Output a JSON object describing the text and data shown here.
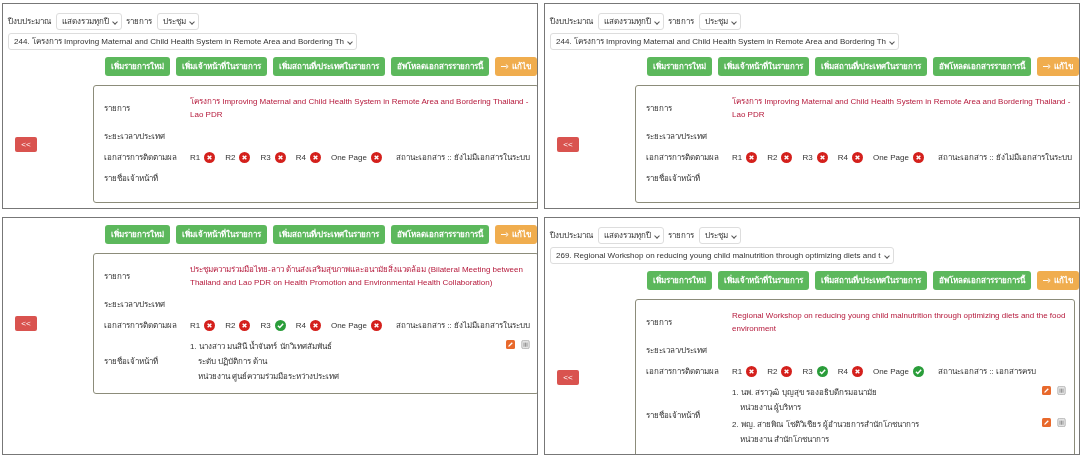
{
  "panels": [
    {
      "filters": {
        "year_label": "ปีงบประมาณ",
        "year": "แสดงรวมทุกปี",
        "type_label": "รายการ",
        "type": "ประชุม",
        "project": "244. โครงการ Improving Maternal and Child Health System in Remote Area and Bordering Th"
      },
      "buttons": [
        "เพิ่มรายการใหม่",
        "เพิ่มเจ้าหน้าที่ในรายการ",
        "เพิ่มสถานที่/ประเทศในรายการ",
        "อัพโหลดเอกสารรายการนี้"
      ],
      "edit_button": "แก้ไข",
      "back_button": "<<",
      "details": {
        "project_label": "รายการ",
        "project": "โครงการ Improving Maternal and Child Health System in Remote Area and Bordering Thailand - Lao PDR",
        "period_label": "ระยะเวลา/ประเทศ",
        "docs_label": "เอกสารการติดตามผล",
        "docs": [
          {
            "label": "R1",
            "done": false
          },
          {
            "label": "R2",
            "done": false
          },
          {
            "label": "R3",
            "done": false
          },
          {
            "label": "R4",
            "done": false
          },
          {
            "label": "One Page",
            "done": false
          }
        ],
        "doc_status": "สถานะเอกสาร :: ยังไม่มีเอกสารในระบบ",
        "staff_label": "รายชื่อเจ้าหน้าที่"
      }
    },
    {
      "filters": {
        "year_label": "ปีงบประมาณ",
        "year": "แสดงรวมทุกปี",
        "type_label": "รายการ",
        "type": "ประชุม",
        "project": "244. โครงการ Improving Maternal and Child Health System in Remote Area and Bordering Th"
      },
      "buttons": [
        "เพิ่มรายการใหม่",
        "เพิ่มเจ้าหน้าที่ในรายการ",
        "เพิ่มสถานที่/ประเทศในรายการ",
        "อัพโหลดเอกสารรายการนี้"
      ],
      "edit_button": "แก้ไข",
      "back_button": "<<",
      "details": {
        "project_label": "รายการ",
        "project": "โครงการ Improving Maternal and Child Health System in Remote Area and Bordering Thailand - Lao PDR",
        "period_label": "ระยะเวลา/ประเทศ",
        "docs_label": "เอกสารการติดตามผล",
        "docs": [
          {
            "label": "R1",
            "done": false
          },
          {
            "label": "R2",
            "done": false
          },
          {
            "label": "R3",
            "done": false
          },
          {
            "label": "R4",
            "done": false
          },
          {
            "label": "One Page",
            "done": false
          }
        ],
        "doc_status": "สถานะเอกสาร :: ยังไม่มีเอกสารในระบบ",
        "staff_label": "รายชื่อเจ้าหน้าที่"
      }
    },
    {
      "buttons": [
        "เพิ่มรายการใหม่",
        "เพิ่มเจ้าหน้าที่ในรายการ",
        "เพิ่มสถานที่/ประเทศในรายการ",
        "อัพโหลดเอกสารรายการนี้"
      ],
      "edit_button": "แก้ไข",
      "back_button": "<<",
      "details": {
        "project_label": "รายการ",
        "project": "ประชุมความร่วมมือไทย-ลาว ด้านส่งเสริมสุขภาพและอนามัยสิ่งแวดล้อม (Bilateral Meeting between Thailand and Lao PDR on Health Promotion and Environmental Health Collaboration)",
        "period_label": "ระยะเวลา/ประเทศ",
        "docs_label": "เอกสารการติดตามผล",
        "docs": [
          {
            "label": "R1",
            "done": false
          },
          {
            "label": "R2",
            "done": false
          },
          {
            "label": "R3",
            "done": true
          },
          {
            "label": "R4",
            "done": false
          },
          {
            "label": "One Page",
            "done": false
          }
        ],
        "doc_status": "สถานะเอกสาร :: ยังไม่มีเอกสารในระบบ",
        "staff_label": "รายชื่อเจ้าหน้าที่",
        "staff": [
          {
            "lines": [
              "1. นางสาว มนสินี น้ำจันทร์ นักวิเทศสัมพันธ์",
              "ระดับ ปฏิบัติการ ด้าน",
              "หน่วยงาน ศูนย์ความร่วมมือระหว่างประเทศ"
            ]
          }
        ]
      }
    },
    {
      "filters": {
        "year_label": "ปีงบประมาณ",
        "year": "แสดงรวมทุกปี",
        "type_label": "รายการ",
        "type": "ประชุม",
        "project": "269. Regional Workshop on reducing young child malnutrition through optimizing diets and t"
      },
      "buttons": [
        "เพิ่มรายการใหม่",
        "เพิ่มเจ้าหน้าที่ในรายการ",
        "เพิ่มสถานที่/ประเทศในรายการ",
        "อัพโหลดเอกสารรายการนี้"
      ],
      "edit_button": "แก้ไข",
      "back_button": "<<",
      "details": {
        "project_label": "รายการ",
        "project": "Regional Workshop on reducing young child malnutrition through optimizing diets and the food environment",
        "period_label": "ระยะเวลา/ประเทศ",
        "docs_label": "เอกสารการติดตามผล",
        "docs": [
          {
            "label": "R1",
            "done": false
          },
          {
            "label": "R2",
            "done": false
          },
          {
            "label": "R3",
            "done": true
          },
          {
            "label": "R4",
            "done": false
          },
          {
            "label": "One Page",
            "done": true
          }
        ],
        "doc_status": "สถานะเอกสาร :: เอกสารครบ",
        "staff_label": "รายชื่อเจ้าหน้าที่",
        "staff": [
          {
            "lines": [
              "1. นพ. สราวุฒิ บุญสุข รองอธิบดีกรมอนามัย",
              "หน่วยงาน ผู้บริหาร"
            ]
          },
          {
            "lines": [
              "2. พญ. สายพิณ โชติวิเชียร ผู้อำนวยการสำนักโภชนาการ",
              "หน่วยงาน สำนักโภชนาการ"
            ]
          }
        ]
      }
    }
  ]
}
